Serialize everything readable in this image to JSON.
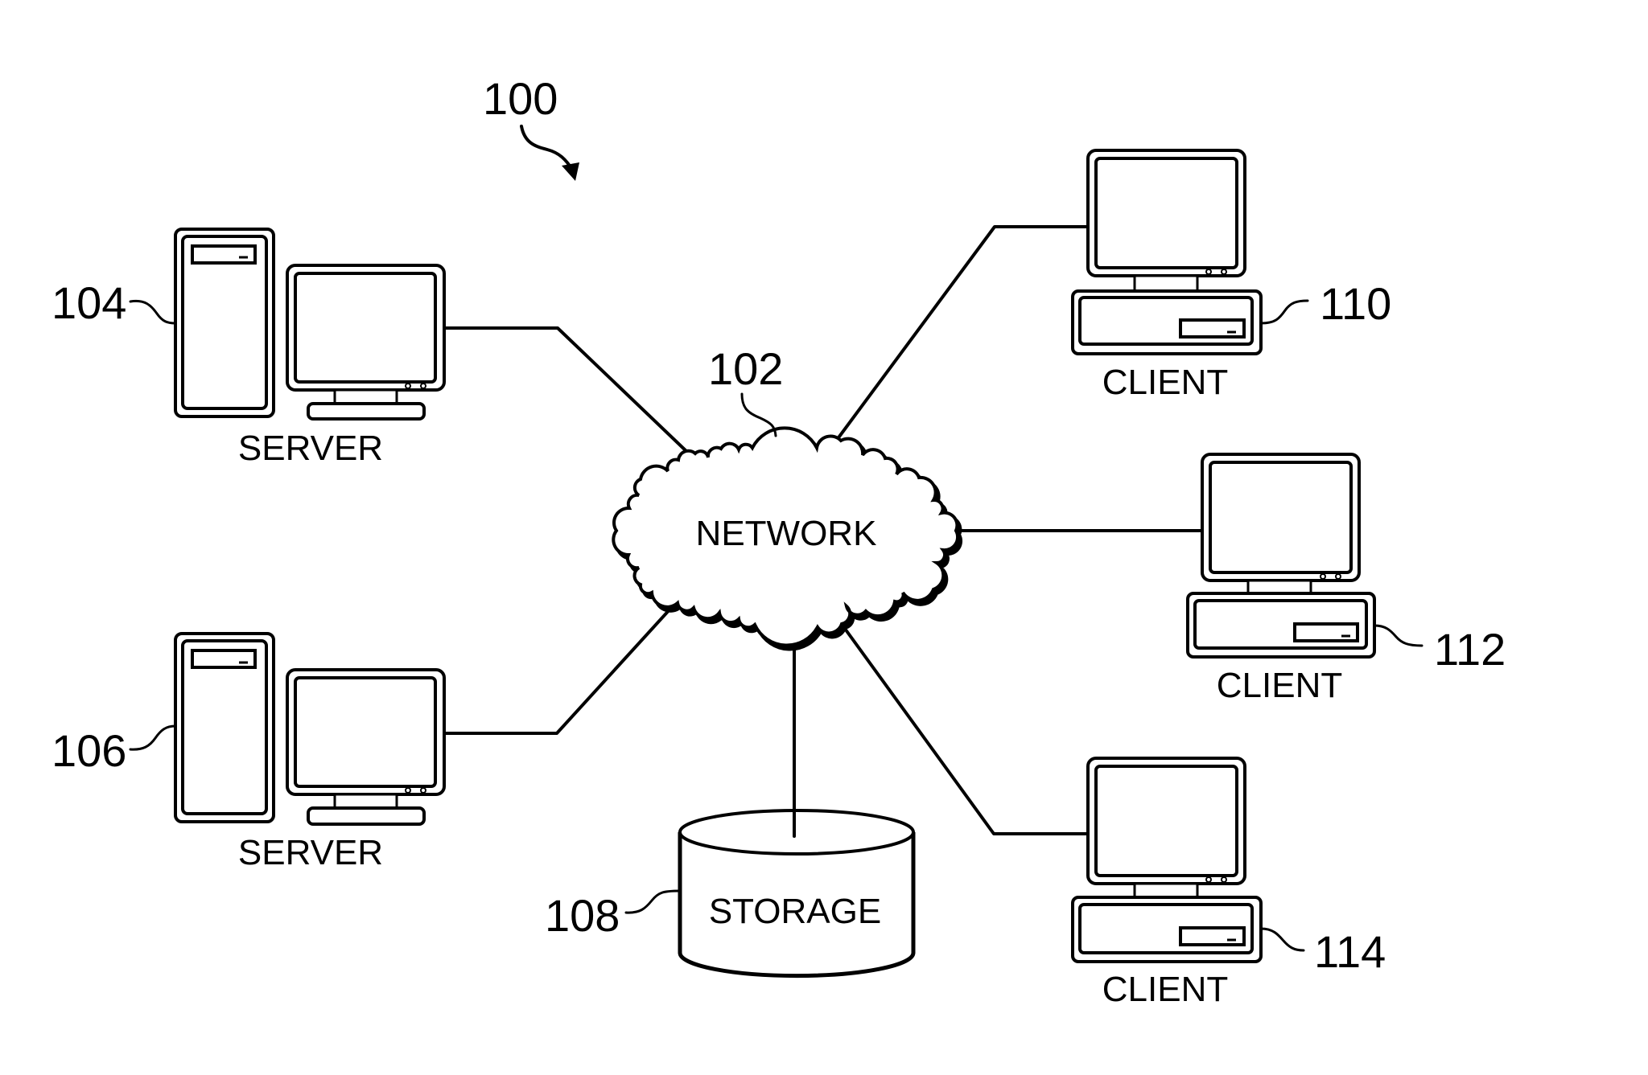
{
  "figure": {
    "ref_label": "100"
  },
  "network": {
    "label": "NETWORK",
    "ref_label": "102"
  },
  "servers": [
    {
      "label": "SERVER",
      "ref_label": "104"
    },
    {
      "label": "SERVER",
      "ref_label": "106"
    }
  ],
  "storage": {
    "label": "STORAGE",
    "ref_label": "108"
  },
  "clients": [
    {
      "label": "CLIENT",
      "ref_label": "110"
    },
    {
      "label": "CLIENT",
      "ref_label": "112"
    },
    {
      "label": "CLIENT",
      "ref_label": "114"
    }
  ],
  "colors": {
    "ink": "#000000",
    "background": "#ffffff"
  }
}
